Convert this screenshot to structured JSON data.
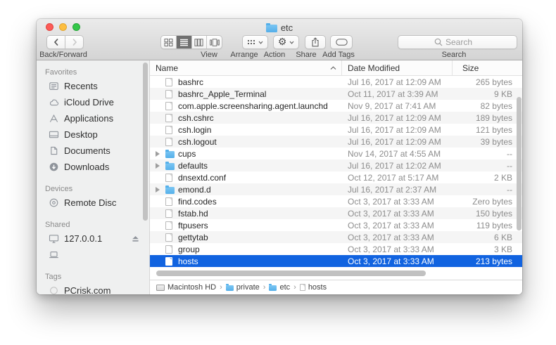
{
  "window": {
    "title": "etc"
  },
  "colors": {
    "accent": "#1163e0",
    "folder_blue": "#55b0ea"
  },
  "toolbar": {
    "back_forward_label": "Back/Forward",
    "view_label": "View",
    "arrange_label": "Arrange",
    "action_label": "Action",
    "share_label": "Share",
    "add_tags_label": "Add Tags",
    "search_label": "Search",
    "search_placeholder": "Search"
  },
  "sidebar": {
    "sections": [
      {
        "title": "Favorites",
        "items": [
          {
            "label": "Recents",
            "icon": "recents-icon"
          },
          {
            "label": "iCloud Drive",
            "icon": "icloud-icon"
          },
          {
            "label": "Applications",
            "icon": "applications-icon"
          },
          {
            "label": "Desktop",
            "icon": "desktop-icon"
          },
          {
            "label": "Documents",
            "icon": "documents-icon"
          },
          {
            "label": "Downloads",
            "icon": "downloads-icon"
          }
        ]
      },
      {
        "title": "Devices",
        "items": [
          {
            "label": "Remote Disc",
            "icon": "disc-icon"
          }
        ]
      },
      {
        "title": "Shared",
        "items": [
          {
            "label": "127.0.0.1",
            "icon": "display-icon",
            "eject": true
          },
          {
            "label": "",
            "icon": "laptop-icon"
          }
        ]
      },
      {
        "title": "Tags",
        "items": [
          {
            "label": "PCrisk.com",
            "icon": "tag-circle-icon"
          }
        ]
      }
    ]
  },
  "list": {
    "columns": [
      "Name",
      "Date Modified",
      "Size"
    ],
    "rows": [
      {
        "name": "bashrc",
        "kind": "file",
        "date": "Jul 16, 2017 at 12:09 AM",
        "size": "265 bytes"
      },
      {
        "name": "bashrc_Apple_Terminal",
        "kind": "file",
        "date": "Oct 11, 2017 at 3:39 AM",
        "size": "9 KB"
      },
      {
        "name": "com.apple.screensharing.agent.launchd",
        "kind": "file",
        "date": "Nov 9, 2017 at 7:41 AM",
        "size": "82 bytes"
      },
      {
        "name": "csh.cshrc",
        "kind": "file",
        "date": "Jul 16, 2017 at 12:09 AM",
        "size": "189 bytes"
      },
      {
        "name": "csh.login",
        "kind": "file",
        "date": "Jul 16, 2017 at 12:09 AM",
        "size": "121 bytes"
      },
      {
        "name": "csh.logout",
        "kind": "file",
        "date": "Jul 16, 2017 at 12:09 AM",
        "size": "39 bytes"
      },
      {
        "name": "cups",
        "kind": "folder",
        "expandable": true,
        "date": "Nov 14, 2017 at 4:55 AM",
        "size": "--"
      },
      {
        "name": "defaults",
        "kind": "folder",
        "expandable": true,
        "date": "Jul 16, 2017 at 12:02 AM",
        "size": "--"
      },
      {
        "name": "dnsextd.conf",
        "kind": "file",
        "date": "Oct 12, 2017 at 5:17 AM",
        "size": "2 KB"
      },
      {
        "name": "emond.d",
        "kind": "folder",
        "expandable": true,
        "date": "Jul 16, 2017 at 2:37 AM",
        "size": "--"
      },
      {
        "name": "find.codes",
        "kind": "file",
        "date": "Oct 3, 2017 at 3:33 AM",
        "size": "Zero bytes"
      },
      {
        "name": "fstab.hd",
        "kind": "file",
        "date": "Oct 3, 2017 at 3:33 AM",
        "size": "150 bytes"
      },
      {
        "name": "ftpusers",
        "kind": "file",
        "date": "Oct 3, 2017 at 3:33 AM",
        "size": "119 bytes"
      },
      {
        "name": "gettytab",
        "kind": "file",
        "date": "Oct 3, 2017 at 3:33 AM",
        "size": "6 KB"
      },
      {
        "name": "group",
        "kind": "file",
        "date": "Oct 3, 2017 at 3:33 AM",
        "size": "3 KB"
      },
      {
        "name": "hosts",
        "kind": "file",
        "date": "Oct 3, 2017 at 3:33 AM",
        "size": "213 bytes",
        "selected": true
      }
    ]
  },
  "pathbar": {
    "separator": "›",
    "items": [
      {
        "label": "Macintosh HD",
        "icon": "drive-icon"
      },
      {
        "label": "private",
        "icon": "folder-icon"
      },
      {
        "label": "etc",
        "icon": "folder-icon"
      },
      {
        "label": "hosts",
        "icon": "file-icon"
      }
    ]
  }
}
